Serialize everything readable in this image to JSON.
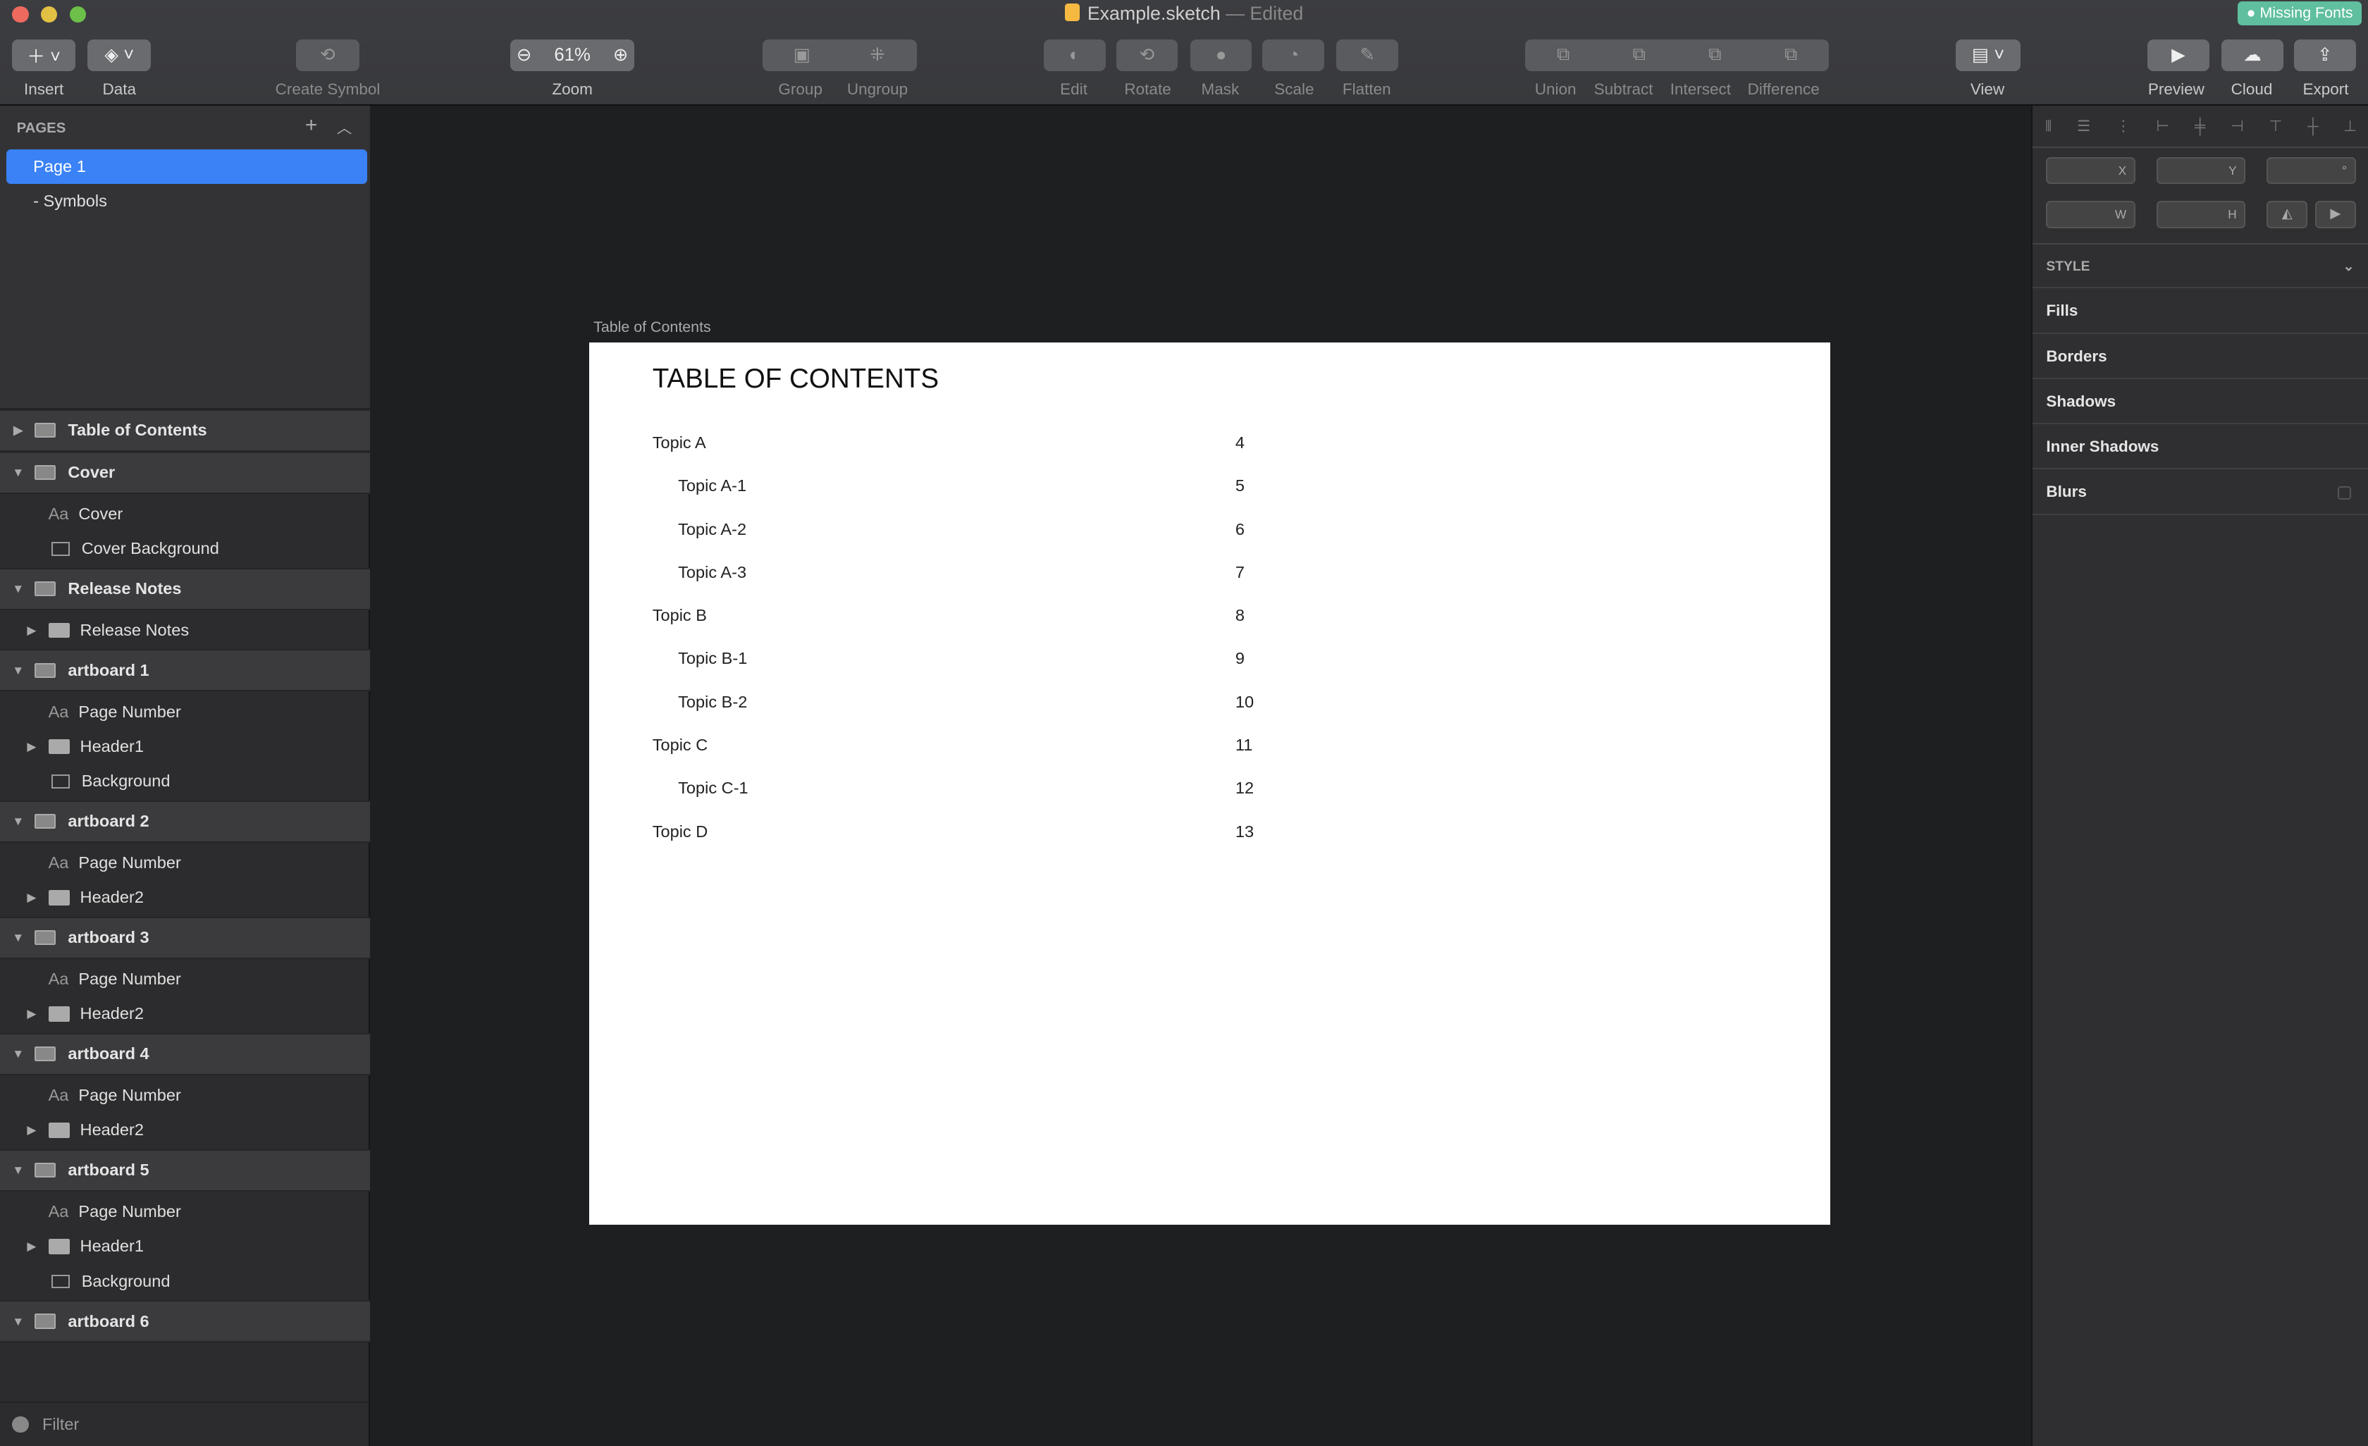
{
  "window": {
    "title": "Example.sketch",
    "status": "— Edited",
    "badge": "Missing Fonts"
  },
  "toolbar": {
    "insert": "Insert",
    "data": "Data",
    "create_symbol": "Create Symbol",
    "zoom_value": "61%",
    "zoom": "Zoom",
    "group": "Group",
    "ungroup": "Ungroup",
    "edit": "Edit",
    "rotate": "Rotate",
    "mask": "Mask",
    "scale": "Scale",
    "flatten": "Flatten",
    "union": "Union",
    "subtract": "Subtract",
    "intersect": "Intersect",
    "difference": "Difference",
    "view": "View",
    "preview": "Preview",
    "cloud": "Cloud",
    "export": "Export"
  },
  "pages": {
    "header": "PAGES",
    "items": [
      "Page 1",
      "- Symbols"
    ]
  },
  "layers": [
    {
      "name": "Table of Contents",
      "expanded": false,
      "children": []
    },
    {
      "name": "Cover",
      "expanded": true,
      "children": [
        {
          "type": "text",
          "name": "Cover"
        },
        {
          "type": "rect",
          "name": "Cover Background"
        }
      ]
    },
    {
      "name": "Release Notes",
      "expanded": true,
      "children": [
        {
          "type": "group",
          "name": "Release Notes"
        }
      ]
    },
    {
      "name": "artboard 1",
      "expanded": true,
      "children": [
        {
          "type": "text",
          "name": "Page Number"
        },
        {
          "type": "group",
          "name": "Header1"
        },
        {
          "type": "rect",
          "name": "Background"
        }
      ]
    },
    {
      "name": "artboard 2",
      "expanded": true,
      "children": [
        {
          "type": "text",
          "name": "Page Number"
        },
        {
          "type": "group",
          "name": "Header2"
        }
      ]
    },
    {
      "name": "artboard 3",
      "expanded": true,
      "children": [
        {
          "type": "text",
          "name": "Page Number"
        },
        {
          "type": "group",
          "name": "Header2"
        }
      ]
    },
    {
      "name": "artboard 4",
      "expanded": true,
      "children": [
        {
          "type": "text",
          "name": "Page Number"
        },
        {
          "type": "group",
          "name": "Header2"
        }
      ]
    },
    {
      "name": "artboard 5",
      "expanded": true,
      "children": [
        {
          "type": "text",
          "name": "Page Number"
        },
        {
          "type": "group",
          "name": "Header1"
        },
        {
          "type": "rect",
          "name": "Background"
        }
      ]
    },
    {
      "name": "artboard 6",
      "expanded": true,
      "children": []
    }
  ],
  "filter": "Filter",
  "artboard": {
    "label": "Table of Contents",
    "heading": "TABLE OF CONTENTS",
    "entries": [
      [
        "Topic A",
        "4",
        0
      ],
      [
        "Topic A-1",
        "5",
        1
      ],
      [
        "Topic A-2",
        "6",
        1
      ],
      [
        "Topic A-3",
        "7",
        1
      ],
      [
        "Topic B",
        "8",
        0
      ],
      [
        "Topic B-1",
        "9",
        1
      ],
      [
        "Topic B-2",
        "10",
        1
      ],
      [
        "Topic C",
        "11",
        0
      ],
      [
        "Topic C-1",
        "12",
        1
      ],
      [
        "Topic D",
        "13",
        0
      ]
    ]
  },
  "inspector": {
    "x": "X",
    "y": "Y",
    "rot": "°",
    "w": "W",
    "h": "H",
    "style": "STYLE",
    "sections": [
      "Fills",
      "Borders",
      "Shadows",
      "Inner Shadows",
      "Blurs"
    ]
  }
}
